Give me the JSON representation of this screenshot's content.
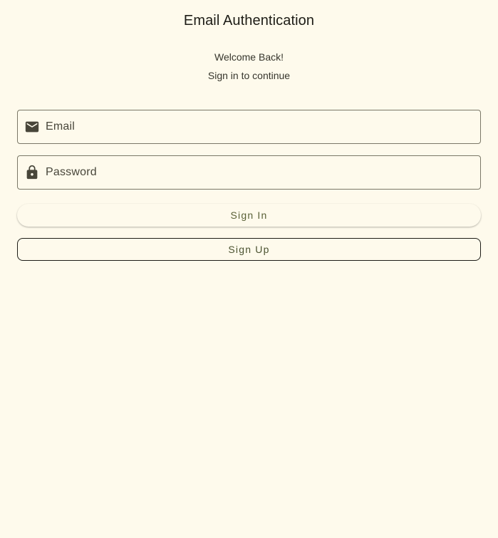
{
  "header": {
    "title": "Email Authentication",
    "welcome": "Welcome Back!",
    "subtitle": "Sign in to continue"
  },
  "form": {
    "email": {
      "placeholder": "Email",
      "value": "",
      "icon": "mail-icon"
    },
    "password": {
      "placeholder": "Password",
      "value": "",
      "icon": "lock-icon"
    }
  },
  "actions": {
    "sign_in_label": "Sign In",
    "sign_up_label": "Sign Up"
  },
  "colors": {
    "background": "#fefaec",
    "primary": "#5a6137",
    "outline": "#7a7767",
    "text": "#1d1c16"
  }
}
